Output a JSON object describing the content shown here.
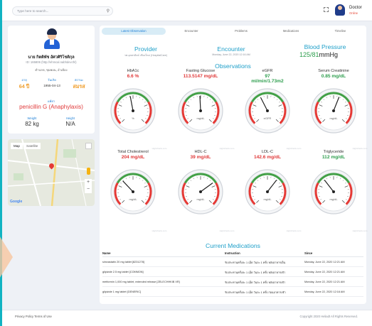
{
  "topbar": {
    "search_placeholder": "Type here to search...",
    "user_name": "Doctor",
    "user_status": "Online"
  },
  "patient": {
    "name": "นาย กิตติพัช อัศวศิริโชติกุล",
    "cid": "ID: 165806 (http://ehmcal.nabhdev.th/)",
    "address": "ตำบลข, ชุมพอน, อำเมือง",
    "age_label": "อายุ",
    "age_value": "64 ปี",
    "birth_label": "วันเกิด",
    "birth_value": "1955-04-13",
    "status_label": "สถานะ",
    "status_value": "สมรส",
    "allergy_label": "แพ้ยา",
    "allergy_value": "penicillin G (Anaphylaxis)",
    "weight_label": "Weight",
    "weight_value": "82 kg",
    "height_label": "Height",
    "height_value": "N/A"
  },
  "map": {
    "tab_map": "Map",
    "tab_satellite": "Satellite",
    "google": "Google"
  },
  "tabs": [
    "Latest Observation",
    "Encounter",
    "Problems",
    "Medications",
    "Timeline"
  ],
  "provider": {
    "title": "Provider",
    "sub": "รพ.อุตตรดิตถ์ เขียงใหม่ (HospitalCare)"
  },
  "encounter": {
    "title": "Encounter",
    "sub": "Monday, June 22, 2020 12:16 AM"
  },
  "bp": {
    "title": "Blood Pressure",
    "value": "125/81",
    "unit": "mmHg"
  },
  "observations_title": "Observations",
  "observations": [
    {
      "name": "HbA1c",
      "value": "6.6 %",
      "color": "#e03a3a",
      "needle": 0.46,
      "unit_label": "%"
    },
    {
      "name": "Fasting Glucose",
      "value": "113.5147 mg/dL",
      "color": "#e03a3a",
      "needle": 0.49,
      "unit_label": "mg/dL"
    },
    {
      "name": "eGFR",
      "value": "97\nml/min/1.73m2",
      "color": "#2e9e4e",
      "needle": 0.4,
      "unit_label": "eGFR"
    },
    {
      "name": "Serum Creatinine",
      "value": "0.85 mg/dL",
      "color": "#2e9e4e",
      "needle": 0.58,
      "unit_label": "mg/dL"
    },
    {
      "name": "Total Cholestrerol",
      "value": "204 mg/dL",
      "color": "#e03a3a",
      "needle": 0.34,
      "unit_label": "mg/dL"
    },
    {
      "name": "HDL-C",
      "value": "39 mg/dL",
      "color": "#e03a3a",
      "needle": 0.7,
      "unit_label": "mg/dL"
    },
    {
      "name": "LDL-C",
      "value": "142.6 mg/dL",
      "color": "#e03a3a",
      "needle": 0.64,
      "unit_label": "mg/dL"
    },
    {
      "name": "Triglyceride",
      "value": "112 mg/dL",
      "color": "#2e9e4e",
      "needle": 0.36,
      "unit_label": "mg/dL"
    }
  ],
  "gauge_watermark": "Highcharts.com",
  "medications": {
    "title": "Current Medications",
    "headers": [
      "Name",
      "Instruction",
      "Since"
    ],
    "rows": [
      [
        "simvastatin 20 mg tablet [8231278]",
        "รับประทานครั้งละ 1 เม็ด วันละ 1 ครั้ง หลังอาหารเย็น",
        "Monday, June 22, 2020 12:21 AM"
      ],
      [
        "glipizide 2.5 mg tablet [COMMON]",
        "รับประทานครั้งละ 1 เม็ด วันละ 1 ครั้ง หลังอาหารเช้า",
        "Monday, June 22, 2020 12:21 AM"
      ],
      [
        "metformin 1,000 mg tablet, extended release [ZELECHHKIB XR]",
        "รับประทานครั้งละ 1 เม็ด วันละ 1 ครั้ง หลังอาหารเช้า",
        "Monday, June 22, 2020 12:21 AM"
      ],
      [
        "glipizide 1 mg tablet [GENERIC]",
        "รับประทานครั้งละ 1 เม็ด วันละ 1 ครั้ง ก่อนอาหารเช้า",
        "Monday, June 22, 2020 12:16 AM"
      ]
    ]
  },
  "footer": {
    "links": "Privacy Policy  Terms of Use",
    "copyright": "Copyright 2020 Heliadt All Rights Reserved."
  }
}
